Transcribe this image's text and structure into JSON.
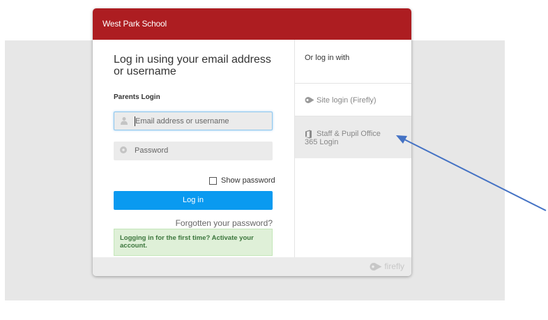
{
  "header": {
    "title": "West Park School"
  },
  "login": {
    "heading": "Log in using your email address or username",
    "subheading": "Parents Login",
    "email_placeholder": "Email address or username",
    "password_placeholder": "Password",
    "show_password_label": "Show password",
    "login_button": "Log in",
    "forgot_link": "Forgotten your password?",
    "activate_notice": "Logging in for the first time? Activate your account."
  },
  "alt_login": {
    "title": "Or log in with",
    "options": [
      {
        "label": "Site login (Firefly)",
        "icon": "firefly-icon"
      },
      {
        "label_line1": "Staff & Pupil Office",
        "label_line2": "365 Login",
        "icon": "office-icon"
      }
    ]
  },
  "footer": {
    "brand": "firefly",
    "icon": "firefly-logo-icon"
  },
  "colors": {
    "header_bg": "#ad1d21",
    "button_bg": "#0a9af0",
    "notice_bg": "#dff0d8",
    "annotation_arrow": "#4472c4"
  }
}
